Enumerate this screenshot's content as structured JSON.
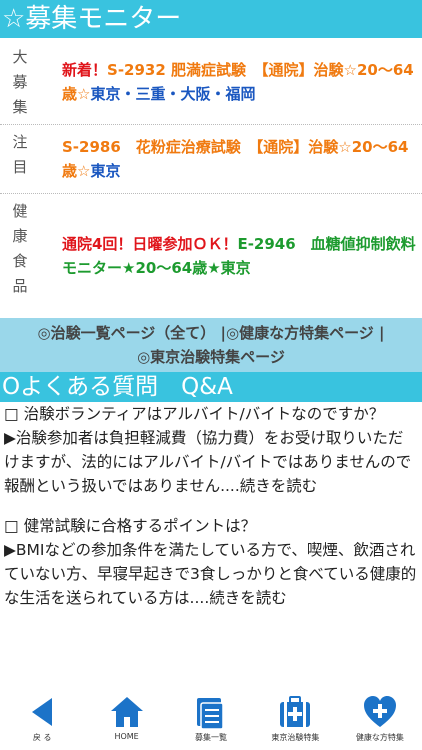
{
  "header_top": {
    "title": "☆募集モニター"
  },
  "table": {
    "rows": [
      {
        "label": [
          "大",
          "募",
          "集"
        ],
        "parts": [
          {
            "text": "新着！",
            "color": "red"
          },
          {
            "text": "S-2932 肥満症試験　【通院】治験☆20〜64歳☆",
            "color": "orange"
          },
          {
            "text": "東京・三重・大阪・福岡",
            "color": "blue"
          }
        ]
      },
      {
        "label": [
          "注",
          "目"
        ],
        "parts": [
          {
            "text": "S-2986　花粉症治療試験　【通院】治験☆20〜64歳☆",
            "color": "orange"
          },
          {
            "text": "東京",
            "color": "blue"
          }
        ]
      },
      {
        "label": [
          "健",
          "康",
          "食",
          "品"
        ],
        "parts": [
          {
            "text": "通院4回！日曜参加ＯＫ！",
            "color": "red"
          },
          {
            "text": "E-2946　血糖値抑制飲料モニター★20〜64歳★東京",
            "color": "green"
          }
        ]
      }
    ]
  },
  "links": {
    "line1": "◎治験一覧ページ（全て） |◎健康な方特集ページ |",
    "line2": "◎東京治験特集ページ"
  },
  "header_faq": {
    "title": "Oよくある質問　Q&A"
  },
  "faq": [
    {
      "q": "□ 治験ボランティアはアルバイト/バイトなのですか？",
      "a": "▶治験参加者は負担軽減費（協力費）をお受け取りいただけますが、法的にはアルバイト/バイトではありませんので報酬という扱いではありません....続きを読む"
    },
    {
      "q": "□ 健常試験に合格するポイントは？",
      "a": "▶BMIなどの参加条件を満たしている方で、喫煙、飲酒されていない方、早寝早起きで3食しっかりと食べている健康的な生活を送られている方は....続きを読む"
    }
  ],
  "nav": {
    "back": "戻 る",
    "home": "HOME",
    "list": "募集一覧",
    "tokyo": "東京治験特集",
    "healthy": "健康な方特集"
  },
  "colors": {
    "accent": "#39c3df",
    "links_bg": "#9ad7ea",
    "nav_icon": "#1c73c8"
  }
}
